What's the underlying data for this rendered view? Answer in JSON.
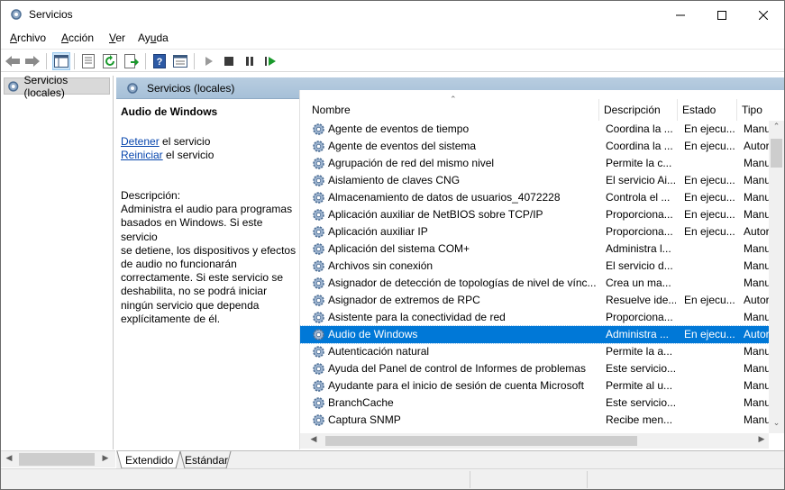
{
  "window": {
    "title": "Servicios"
  },
  "menu": [
    {
      "pre": "",
      "ul": "A",
      "post": "rchivo"
    },
    {
      "pre": "",
      "ul": "A",
      "post": "cción"
    },
    {
      "pre": "",
      "ul": "V",
      "post": "er"
    },
    {
      "pre": "Ay",
      "ul": "u",
      "post": "da"
    }
  ],
  "toolbar": {
    "icons": [
      "back-icon",
      "forward-icon",
      "console-tree-icon",
      "properties-icon",
      "refresh-icon",
      "export-list-icon",
      "help-icon",
      "view-icon",
      "start-service-icon",
      "stop-service-icon",
      "pause-service-icon",
      "restart-service-icon"
    ]
  },
  "tree": {
    "item": "Servicios (locales)"
  },
  "panel": {
    "header": "Servicios (locales)"
  },
  "details": {
    "service_name": "Audio de Windows",
    "stop_link": "Detener",
    "stop_suffix": " el servicio",
    "restart_link": "Reiniciar",
    "restart_suffix": " el servicio",
    "description_label": "Descripción:",
    "description_lines": [
      "Administra el audio para programas",
      "basados en Windows. Si este servicio",
      "se detiene, los dispositivos y efectos",
      "de audio no funcionarán",
      "correctamente. Si este servicio se",
      "deshabilita, no se podrá iniciar",
      "ningún servicio que dependa",
      "explícitamente de él."
    ]
  },
  "columns": [
    "Nombre",
    "Descripción",
    "Estado",
    "Tipo"
  ],
  "services": [
    {
      "name": "Agente de eventos de tiempo",
      "desc": "Coordina la ...",
      "status": "En ejecu...",
      "type": "Manu",
      "selected": false
    },
    {
      "name": "Agente de eventos del sistema",
      "desc": "Coordina la ...",
      "status": "En ejecu...",
      "type": "Autor",
      "selected": false
    },
    {
      "name": "Agrupación de red del mismo nivel",
      "desc": "Permite la c...",
      "status": "",
      "type": "Manu",
      "selected": false
    },
    {
      "name": "Aislamiento de claves CNG",
      "desc": "El servicio Ai...",
      "status": "En ejecu...",
      "type": "Manu",
      "selected": false
    },
    {
      "name": "Almacenamiento de datos de usuarios_4072228",
      "desc": "Controla el ...",
      "status": "En ejecu...",
      "type": "Manu",
      "selected": false
    },
    {
      "name": "Aplicación auxiliar de NetBIOS sobre TCP/IP",
      "desc": "Proporciona...",
      "status": "En ejecu...",
      "type": "Manu",
      "selected": false
    },
    {
      "name": "Aplicación auxiliar IP",
      "desc": "Proporciona...",
      "status": "En ejecu...",
      "type": "Autor",
      "selected": false
    },
    {
      "name": "Aplicación del sistema COM+",
      "desc": "Administra l...",
      "status": "",
      "type": "Manu",
      "selected": false
    },
    {
      "name": "Archivos sin conexión",
      "desc": "El servicio d...",
      "status": "",
      "type": "Manu",
      "selected": false
    },
    {
      "name": "Asignador de detección de topologías de nivel de vínc...",
      "desc": "Crea un ma...",
      "status": "",
      "type": "Manu",
      "selected": false
    },
    {
      "name": "Asignador de extremos de RPC",
      "desc": "Resuelve ide...",
      "status": "En ejecu...",
      "type": "Autor",
      "selected": false
    },
    {
      "name": "Asistente para la conectividad de red",
      "desc": "Proporciona...",
      "status": "",
      "type": "Manu",
      "selected": false
    },
    {
      "name": "Audio de Windows",
      "desc": "Administra ...",
      "status": "En ejecu...",
      "type": "Autor",
      "selected": true
    },
    {
      "name": "Autenticación natural",
      "desc": "Permite la a...",
      "status": "",
      "type": "Manu",
      "selected": false
    },
    {
      "name": "Ayuda del Panel de control de Informes de problemas",
      "desc": "Este servicio...",
      "status": "",
      "type": "Manu",
      "selected": false
    },
    {
      "name": "Ayudante para el inicio de sesión de cuenta Microsoft",
      "desc": "Permite al u...",
      "status": "",
      "type": "Manu",
      "selected": false
    },
    {
      "name": "BranchCache",
      "desc": "Este servicio...",
      "status": "",
      "type": "Manu",
      "selected": false
    },
    {
      "name": "Captura SNMP",
      "desc": "Recibe men...",
      "status": "",
      "type": "Manu",
      "selected": false
    }
  ],
  "tabs": [
    "Extendido",
    "Estándar"
  ],
  "colors": {
    "selection": "#0078d7",
    "header_band": "#a6c0d8",
    "link": "#0645ad"
  }
}
